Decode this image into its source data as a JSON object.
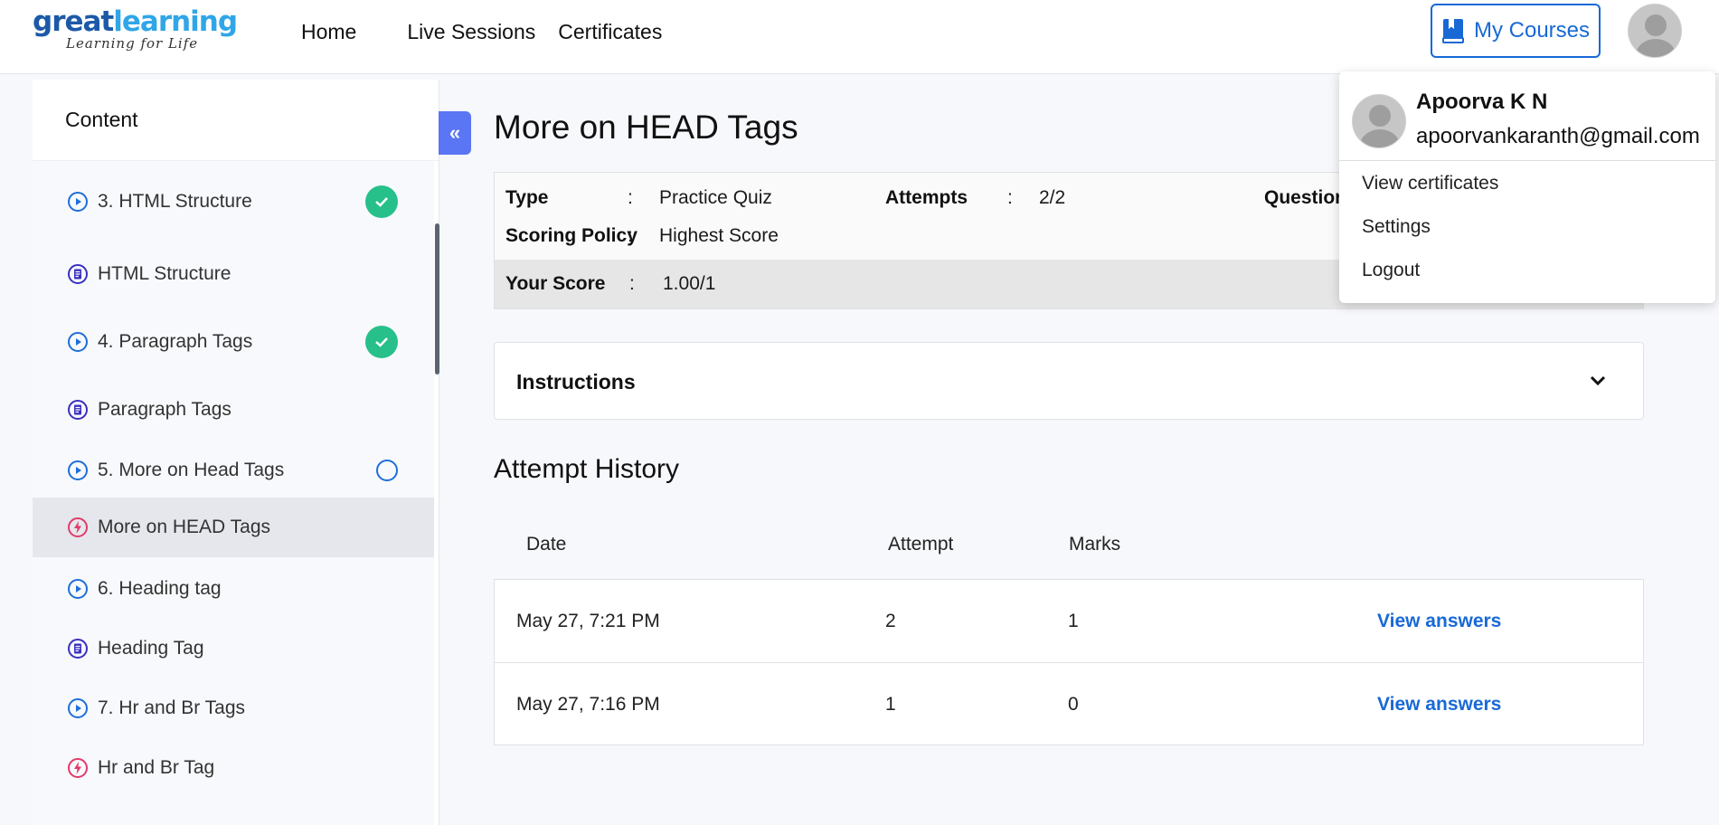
{
  "colors": {
    "accent": "#1869d6",
    "success": "#27c08a",
    "collapse": "#5a76f4",
    "quiz_icon": "#e33a6a",
    "doc_icon": "#3a30c0"
  },
  "logo": {
    "part1": "great",
    "part2": "learning",
    "tagline": "Learning for Life"
  },
  "nav": {
    "home": "Home",
    "live_sessions": "Live Sessions",
    "certificates": "Certificates",
    "my_courses": "My Courses"
  },
  "sidebar": {
    "title": "Content",
    "items": [
      {
        "label": "3. HTML Structure",
        "icon": "play-circle-icon",
        "status": "completed"
      },
      {
        "label": "HTML Structure",
        "icon": "document-icon",
        "status": ""
      },
      {
        "label": "4. Paragraph Tags",
        "icon": "play-circle-icon",
        "status": "completed"
      },
      {
        "label": "Paragraph Tags",
        "icon": "document-icon",
        "status": ""
      },
      {
        "label": "5. More on Head Tags",
        "icon": "play-circle-icon",
        "status": "in-progress"
      },
      {
        "label": "More on HEAD Tags",
        "icon": "quiz-bolt-icon",
        "status": "active"
      },
      {
        "label": "6. Heading tag",
        "icon": "play-circle-icon",
        "status": ""
      },
      {
        "label": "Heading Tag",
        "icon": "document-icon",
        "status": ""
      },
      {
        "label": "7. Hr and Br Tags",
        "icon": "play-circle-icon",
        "status": ""
      },
      {
        "label": "Hr and Br Tag",
        "icon": "quiz-bolt-icon",
        "status": ""
      }
    ]
  },
  "quiz": {
    "title": "More on HEAD Tags",
    "type_label": "Type",
    "type_value": "Practice Quiz",
    "attempts_label": "Attempts",
    "attempts_value": "2/2",
    "questions_label": "Question",
    "scoring_label": "Scoring Policy",
    "scoring_value": "Highest Score",
    "score_label": "Your Score",
    "score_value": "1.00/1",
    "colon": ":",
    "instructions": "Instructions"
  },
  "history": {
    "title": "Attempt History",
    "columns": [
      "Date",
      "Attempt",
      "Marks"
    ],
    "rows": [
      {
        "date": "May 27, 7:21 PM",
        "attempt": "2",
        "marks": "1",
        "action": "View answers"
      },
      {
        "date": "May 27, 7:16 PM",
        "attempt": "1",
        "marks": "0",
        "action": "View answers"
      }
    ]
  },
  "profile_menu": {
    "name": "Apoorva K N",
    "email": "apoorvankaranth@gmail.com",
    "items": [
      "View certificates",
      "Settings",
      "Logout"
    ]
  }
}
